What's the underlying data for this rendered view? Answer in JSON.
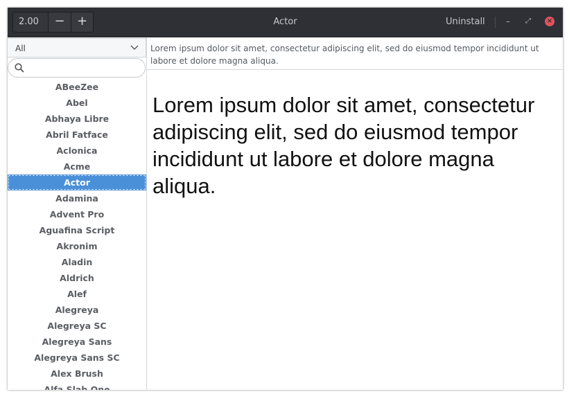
{
  "headerbar": {
    "zoom_value": "2.00",
    "zoom_out_label": "−",
    "zoom_in_label": "+",
    "title": "Actor",
    "uninstall_label": "Uninstall",
    "minimize_glyph": "–",
    "maximize_glyph": "⤢",
    "close_glyph": "×"
  },
  "sidebar": {
    "filter_value": "All",
    "search_placeholder": "",
    "selected_index": 6,
    "fonts": [
      "ABeeZee",
      "Abel",
      "Abhaya Libre",
      "Abril Fatface",
      "Aclonica",
      "Acme",
      "Actor",
      "Adamina",
      "Advent Pro",
      "Aguafina Script",
      "Akronim",
      "Aladin",
      "Aldrich",
      "Alef",
      "Alegreya",
      "Alegreya SC",
      "Alegreya Sans",
      "Alegreya Sans SC",
      "Alex Brush",
      "Alfa Slab One"
    ]
  },
  "preview": {
    "sample_entry": "Lorem ipsum dolor sit amet, consectetur adipiscing elit, sed do eiusmod tempor incididunt ut labore et dolore magna aliqua.",
    "sample_text": "Lorem ipsum dolor sit amet, consectetur adipiscing elit, sed do eiusmod tempor incididunt ut labore et dolore magna aliqua."
  },
  "colors": {
    "headerbar_bg": "#2e3035",
    "selection": "#4a90d9",
    "close_button": "#e0525d"
  },
  "icons": [
    "chevron-down-icon",
    "search-icon",
    "minimize-icon",
    "maximize-icon",
    "close-icon"
  ]
}
